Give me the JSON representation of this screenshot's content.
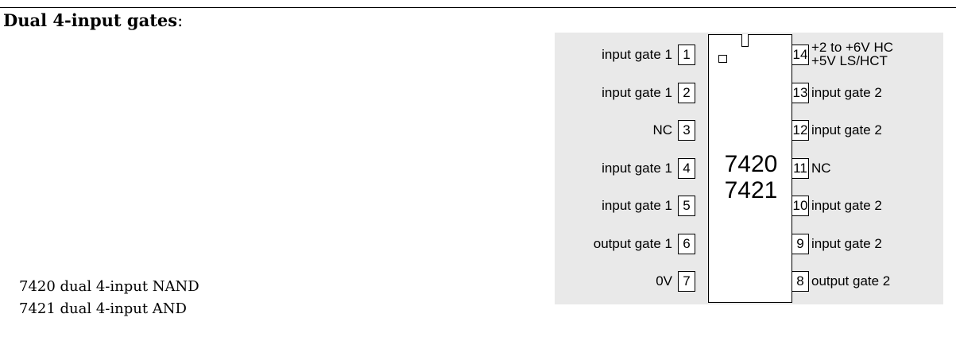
{
  "heading": {
    "bold": "Dual 4-input gates",
    "suffix": ":"
  },
  "descriptions": [
    "7420 dual 4-input NAND",
    "7421 dual 4-input AND"
  ],
  "chip": {
    "labels": [
      "7420",
      "7421"
    ],
    "left_pins": [
      {
        "number": "1",
        "label": "input gate 1"
      },
      {
        "number": "2",
        "label": "input gate 1"
      },
      {
        "number": "3",
        "label": "NC"
      },
      {
        "number": "4",
        "label": "input gate 1"
      },
      {
        "number": "5",
        "label": "input gate 1"
      },
      {
        "number": "6",
        "label": "output gate 1"
      },
      {
        "number": "7",
        "label": "0V"
      }
    ],
    "right_pins": [
      {
        "number": "14",
        "label": "+2 to +6V HC",
        "label2": "+5V LS/HCT"
      },
      {
        "number": "13",
        "label": "input gate 2"
      },
      {
        "number": "12",
        "label": "input gate 2"
      },
      {
        "number": "11",
        "label": "NC"
      },
      {
        "number": "10",
        "label": "input gate 2"
      },
      {
        "number": "9",
        "label": "input gate 2"
      },
      {
        "number": "8",
        "label": "output gate 2"
      }
    ]
  }
}
